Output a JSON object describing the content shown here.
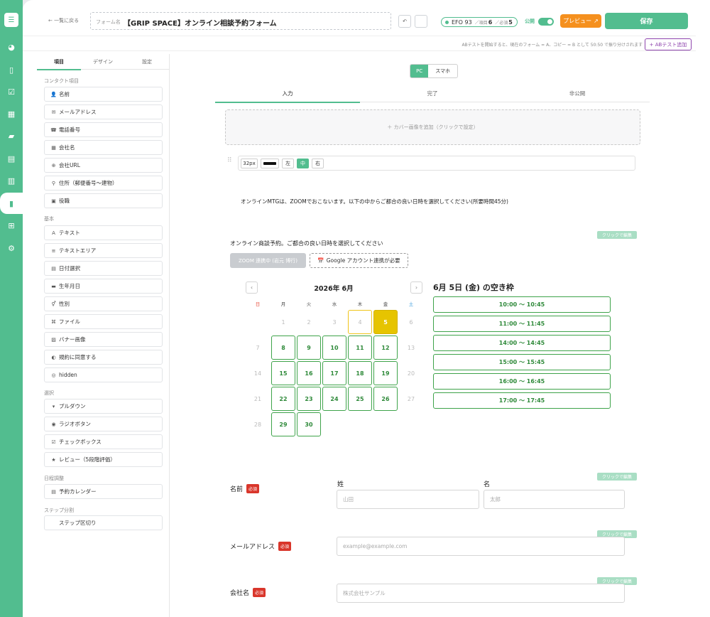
{
  "rail": {
    "icons": [
      "menu-icon",
      "dashboard-icon",
      "clipboard-icon",
      "checklist-icon",
      "building-icon",
      "folder-icon",
      "calculator-icon",
      "calendar-icon",
      "document-icon",
      "layout-icon",
      "gear-icon"
    ]
  },
  "header": {
    "back_label": "← 一覧に戻る",
    "form_name_label": "フォーム名",
    "form_name_value": "【GRIP SPACE】オンライン相談予約フォーム",
    "efo_label": "EFO 93",
    "items_label": "／項目",
    "items_count": "6",
    "required_label": "／必須",
    "required_count": "5",
    "publish_label": "公開",
    "preview_label": "プレビュー",
    "save_label": "保存",
    "ab_notice": "ABテストを開始すると、現在のフォーム = A、コピー = B として 50:50 で振り分けされます",
    "ab_button": "+ ABテスト追加"
  },
  "sidebar": {
    "tabs": [
      "項目",
      "デザイン",
      "設定"
    ],
    "sections": {
      "contact": "コンタクト項目",
      "basic": "基本",
      "select": "選択",
      "schedule": "日程調整",
      "step": "ステップ分割"
    },
    "contact_items": [
      {
        "label": "名前",
        "icon": "👤"
      },
      {
        "label": "メールアドレス",
        "icon": "✉"
      },
      {
        "label": "電話番号",
        "icon": "☎"
      },
      {
        "label": "会社名",
        "icon": "▦"
      },
      {
        "label": "会社URL",
        "icon": "⊕"
      },
      {
        "label": "住所（郵便番号〜建物）",
        "icon": "⚲"
      },
      {
        "label": "役職",
        "icon": "▣"
      }
    ],
    "basic_items": [
      {
        "label": "テキスト",
        "icon": "A"
      },
      {
        "label": "テキストエリア",
        "icon": "≡"
      },
      {
        "label": "日付選択",
        "icon": "▤"
      },
      {
        "label": "生年月日",
        "icon": "▬"
      },
      {
        "label": "性別",
        "icon": "⚥"
      },
      {
        "label": "ファイル",
        "icon": "⌘"
      },
      {
        "label": "バナー画像",
        "icon": "▨"
      },
      {
        "label": "規約に同意する",
        "icon": "◐"
      },
      {
        "label": "hidden",
        "icon": "◎"
      }
    ],
    "select_items": [
      {
        "label": "プルダウン",
        "icon": "▾"
      },
      {
        "label": "ラジオボタン",
        "icon": "◉"
      },
      {
        "label": "チェックボックス",
        "icon": "☑"
      },
      {
        "label": "レビュー（5段階評価）",
        "icon": "★"
      }
    ],
    "schedule_items": [
      {
        "label": "予約カレンダー",
        "icon": "▤"
      }
    ],
    "step_items": [
      {
        "label": "ステップ区切り",
        "icon": ""
      }
    ]
  },
  "editor": {
    "device": [
      "PC",
      "スマホ"
    ],
    "stages": [
      "入力",
      "完了",
      "非公開"
    ],
    "cover_hint": "＋ カバー画像を追加（クリックで設定）",
    "toolbar": {
      "size": "32px",
      "left": "左",
      "center": "中",
      "right": "右"
    },
    "intro_text": "オンラインMTGは、ZOOMでおこないます。以下の中からご都合の良い日時を選択してください(所要時間45分)",
    "edit_chip": "クリックで編集",
    "booking_title": "オンライン商談予約。ご都合の良い日時を選択してください",
    "zoom_button": "ZOOM 連携中 (岩元 博行)",
    "gcal_button": "Google アカウント連携が必要",
    "calendar": {
      "prev": "‹",
      "next": "›",
      "month_label": "2026年 6月",
      "weekdays": [
        "日",
        "月",
        "火",
        "水",
        "木",
        "金",
        "土"
      ],
      "weeks": [
        [
          "",
          "1",
          "2",
          "3",
          "4",
          "5",
          "6"
        ],
        [
          "7",
          "8",
          "9",
          "10",
          "11",
          "12",
          "13"
        ],
        [
          "14",
          "15",
          "16",
          "17",
          "18",
          "19",
          "20"
        ],
        [
          "21",
          "22",
          "23",
          "24",
          "25",
          "26",
          "27"
        ],
        [
          "28",
          "29",
          "30",
          "",
          "",
          "",
          ""
        ]
      ],
      "available_days": [
        "8",
        "9",
        "10",
        "11",
        "12",
        "15",
        "16",
        "17",
        "18",
        "19",
        "22",
        "23",
        "24",
        "25",
        "26",
        "29",
        "30"
      ],
      "today": "4",
      "selected": "5"
    },
    "slots_title": "6月 5日 (金) の空き枠",
    "slots": [
      "10:00 〜 10:45",
      "11:00 〜 11:45",
      "14:00 〜 14:45",
      "15:00 〜 15:45",
      "16:00 〜 16:45",
      "17:00 〜 17:45"
    ],
    "fields": {
      "name_label": "名前",
      "required": "必須",
      "last_label": "姓",
      "first_label": "名",
      "last_placeholder": "山田",
      "first_placeholder": "太郎",
      "email_label": "メールアドレス",
      "email_placeholder": "example@example.com",
      "company_label": "会社名",
      "company_placeholder": "株式会社サンプル"
    }
  },
  "colors": {
    "brand": "#52bd8f",
    "preview": "#f5901e",
    "required": "#d9362b",
    "available": "#3ea34a",
    "selected": "#e6c400"
  }
}
